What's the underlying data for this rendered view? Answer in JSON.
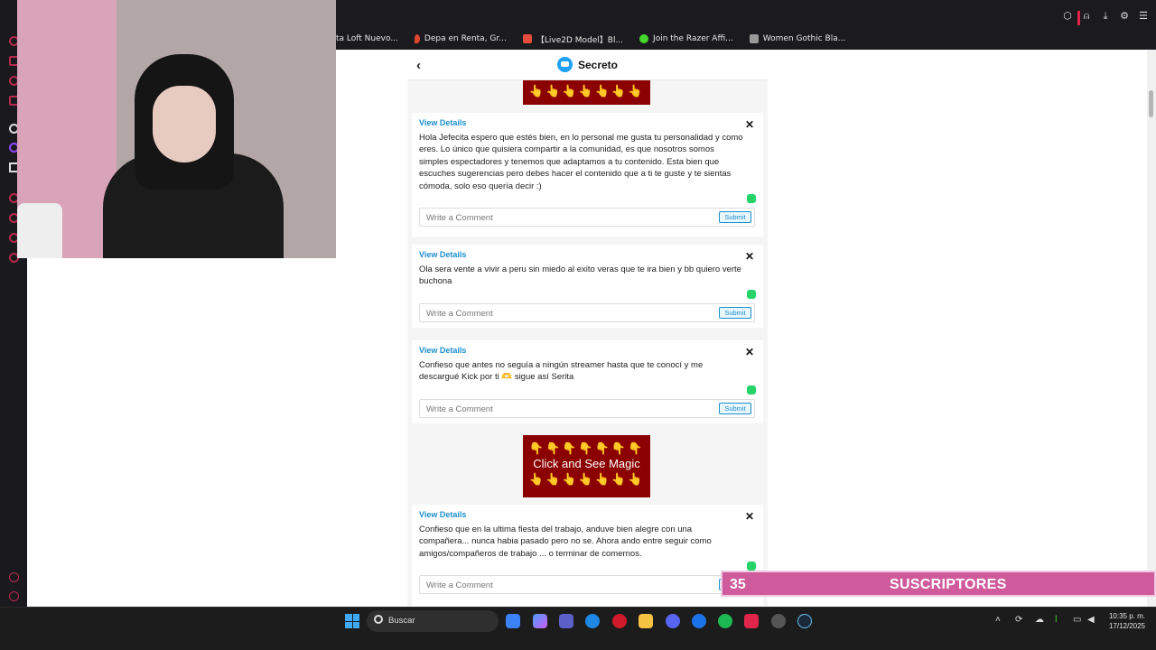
{
  "browser": {
    "bookmarks": [
      {
        "label": "ta Loft Nuevo...",
        "color": "#d4552b"
      },
      {
        "label": "Depa en Renta, Gr...",
        "color": "#e0452f"
      },
      {
        "label": "【Live2D Model】Bl...",
        "color": "#e74c3c"
      },
      {
        "label": "Join the Razer Affi...",
        "color": "#44d62c"
      },
      {
        "label": "Women Gothic Bla...",
        "color": "#9a9a9a"
      }
    ]
  },
  "app": {
    "title": "Secreto",
    "ad": {
      "hands": "👇👇👇👇👇👇👇",
      "text": "Click and See Magic",
      "hands_up": "👆👆👆👆👆👆👆"
    },
    "link_label": "View Details",
    "comment_placeholder": "Write a Comment",
    "submit_label": "Submit",
    "posts": [
      {
        "text": "Hola Jefecita espero que estés bien, en lo personal me gusta tu personalidad y como eres. Lo único que quisiera compartir a la comunidad, es que nosotros somos simples espectadores y tenemos que adaptamos a tu contenido. Esta bien que escuches sugerencias pero debes hacer el contenido que a ti te guste y te sientas cómoda, solo eso quería decir :)"
      },
      {
        "text": "Ola sera vente a vivir a peru sin miedo al exito veras que te ira bien y bb quiero verte buchona"
      },
      {
        "text": "Confieso que antes no seguía a ningún streamer hasta que te conocí y me descargué Kick por ti 🫶 sigue así Serita"
      },
      {
        "text": "Confieso que en la ultima fiesta del trabajo, anduve bien alegre con una compañera... nunca habia pasado pero no se. Ahora ando entre seguir como amigos/compañeros de trabajo ... o terminar de comernos."
      }
    ]
  },
  "overlay": {
    "subs_count": "35",
    "subs_label": "SUSCRIPTORES"
  },
  "taskbar": {
    "search_label": "Buscar",
    "time": "10:35 p. m.",
    "date": "17/12/2025"
  }
}
